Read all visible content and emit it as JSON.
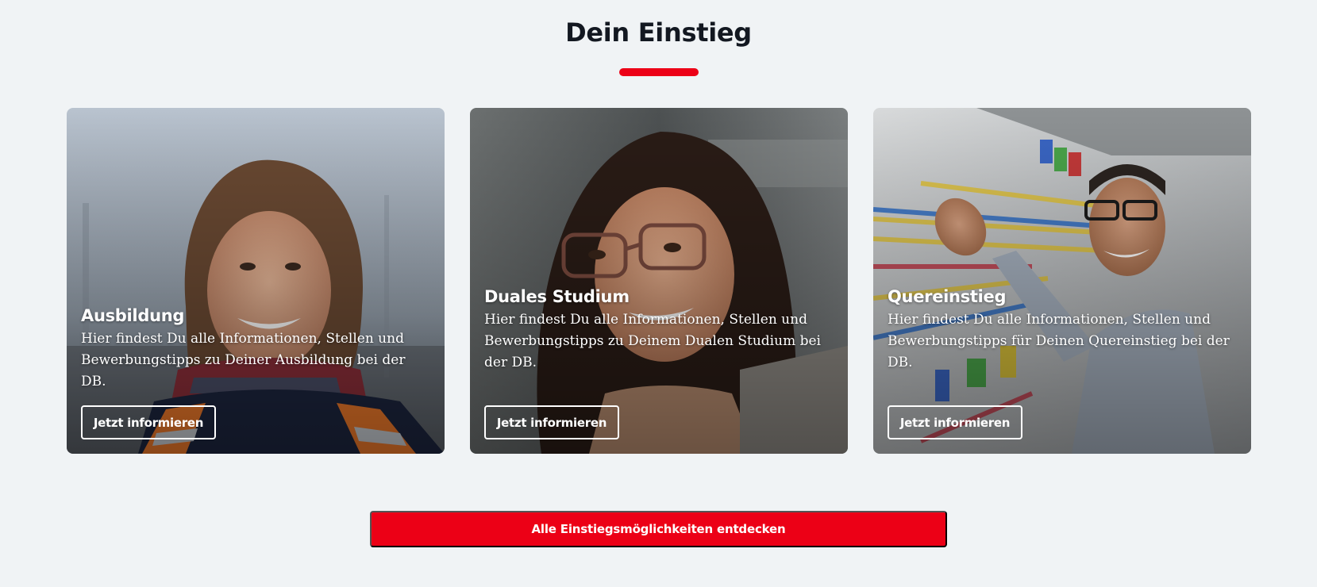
{
  "section": {
    "heading": "Dein Einstieg",
    "accent_color": "#ec0016"
  },
  "cards": [
    {
      "title": "Ausbildung",
      "description": "Hier findest Du alle Informationen, Stellen und Bewerbungstipps zu Deiner Ausbildung bei der DB.",
      "button_label": "Jetzt informieren",
      "image_subject": "smiling woman with scarf and orange safety vest outdoors"
    },
    {
      "title": "Duales Studium",
      "description": "Hier findest Du alle Informationen, Stellen und Bewerbungstipps zu Deinem Dualen Studium bei der DB.",
      "button_label": "Jetzt informieren",
      "image_subject": "smiling woman with glasses and dark curly hair"
    },
    {
      "title": "Quereinstieg",
      "description": "Hier findest Du alle Informationen, Stellen und Bewerbungstipps für Deinen Quereinstieg bei der DB.",
      "button_label": "Jetzt informieren",
      "image_subject": "man with glasses pointing at railway signal control panel"
    }
  ],
  "cta": {
    "label": "Alle Einstiegsmöglichkeiten entdecken"
  }
}
